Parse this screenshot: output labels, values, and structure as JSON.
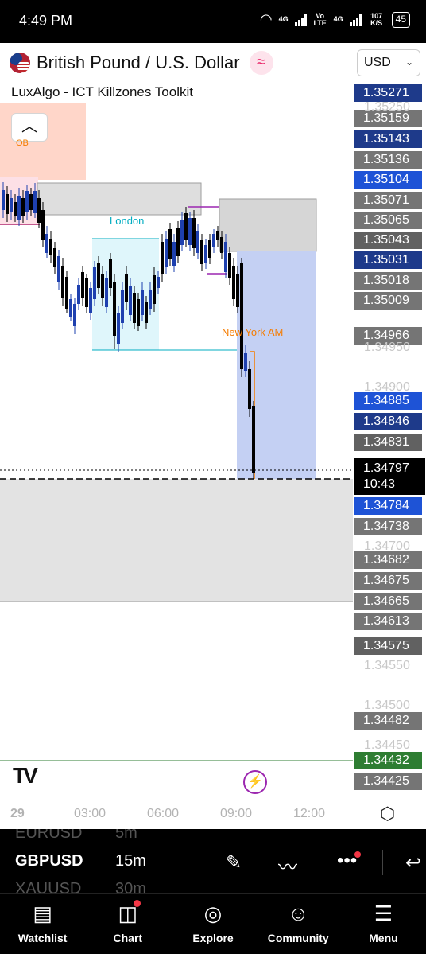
{
  "status": {
    "time": "4:49 PM",
    "net1": "4G",
    "volte": "Vo LTE",
    "net2": "4G",
    "speed": "107 K/S",
    "battery": "45"
  },
  "header": {
    "symbol_title": "British Pound / U.S. Dollar",
    "currency": "USD",
    "indicator": "LuxAlgo - ICT Killzones Toolkit",
    "flag_icon": "gbp-usd-flag-icon",
    "wave_icon": "wave-icon"
  },
  "chart_labels": {
    "ob": "OB",
    "london": "London",
    "new_york": "New York AM"
  },
  "price_labels": [
    {
      "text": "1.35271",
      "color": "#1e3a8a"
    },
    {
      "text": "1.35159",
      "color": "#757575"
    },
    {
      "text": "1.35143",
      "color": "#1e3a8a"
    },
    {
      "text": "1.35136",
      "color": "#757575"
    },
    {
      "text": "1.35104",
      "color": "#1e53d6"
    },
    {
      "text": "1.35071",
      "color": "#757575"
    },
    {
      "text": "1.35065",
      "color": "#757575"
    },
    {
      "text": "1.35043",
      "color": "#616161"
    },
    {
      "text": "1.35031",
      "color": "#1e3a8a"
    },
    {
      "text": "1.35018",
      "color": "#757575"
    },
    {
      "text": "1.35009",
      "color": "#757575"
    },
    {
      "text": "1.34966",
      "color": "#757575"
    },
    {
      "text": "1.34885",
      "color": "#1e53d6"
    },
    {
      "text": "1.34846",
      "color": "#1e3a8a"
    },
    {
      "text": "1.34831",
      "color": "#616161"
    },
    {
      "text": "1.34784",
      "color": "#1e53d6"
    },
    {
      "text": "1.34738",
      "color": "#757575"
    },
    {
      "text": "1.34682",
      "color": "#757575"
    },
    {
      "text": "1.34675",
      "color": "#757575"
    },
    {
      "text": "1.34665",
      "color": "#757575"
    },
    {
      "text": "1.34613",
      "color": "#757575"
    },
    {
      "text": "1.34575",
      "color": "#616161"
    },
    {
      "text": "1.34482",
      "color": "#757575"
    },
    {
      "text": "1.34432",
      "color": "#2e7d32"
    },
    {
      "text": "1.34425",
      "color": "#757575"
    }
  ],
  "price_ticks": [
    "1.35250",
    "1.34950",
    "1.34900",
    "1.34700",
    "1.34550",
    "1.34500",
    "1.34450"
  ],
  "current_price": {
    "price": "1.34797",
    "countdown": "10:43"
  },
  "time_axis": [
    "29",
    "03:00",
    "06:00",
    "09:00",
    "12:00"
  ],
  "symbol_strip": {
    "prev_symbol": "EURUSD",
    "prev_tf": "5m",
    "symbol": "GBPUSD",
    "timeframe": "15m",
    "next_symbol": "XAUUSD",
    "next_tf": "30m"
  },
  "nav": [
    {
      "label": "Watchlist",
      "icon": "watchlist-icon"
    },
    {
      "label": "Chart",
      "icon": "chart-icon"
    },
    {
      "label": "Explore",
      "icon": "compass-icon"
    },
    {
      "label": "Community",
      "icon": "community-icon"
    },
    {
      "label": "Menu",
      "icon": "hamburger-icon"
    }
  ]
}
